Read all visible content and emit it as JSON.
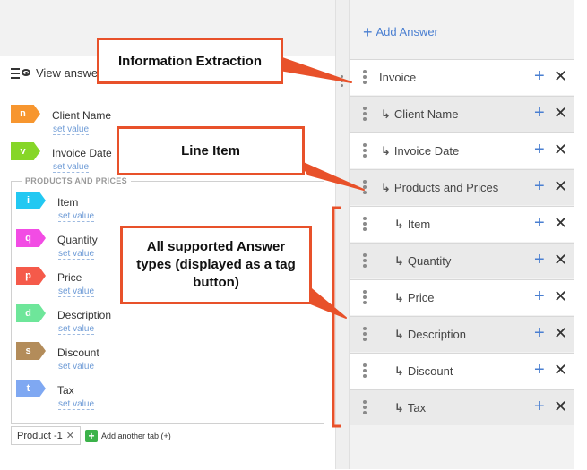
{
  "left": {
    "view_answers_label": "View answers",
    "fields": [
      {
        "tag": "n",
        "label": "Client Name",
        "set": "set value",
        "color": "#f7962f"
      },
      {
        "tag": "v",
        "label": "Invoice Date",
        "set": "set value",
        "color": "#86d628"
      }
    ],
    "group": {
      "title": "PRODUCTS AND PRICES",
      "items": [
        {
          "tag": "i",
          "label": "Item",
          "set": "set value",
          "color": "#22c8f2"
        },
        {
          "tag": "q",
          "label": "Quantity",
          "set": "set value",
          "color": "#f24ce4"
        },
        {
          "tag": "p",
          "label": "Price",
          "set": "set value",
          "color": "#f55a4a"
        },
        {
          "tag": "d",
          "label": "Description",
          "set": "set value",
          "color": "#6ee69a"
        },
        {
          "tag": "s",
          "label": "Discount",
          "set": "set value",
          "color": "#b38c5a"
        },
        {
          "tag": "t",
          "label": "Tax",
          "set": "set value",
          "color": "#7fa8f2"
        }
      ]
    },
    "tabs": {
      "product_tab": "Product -1",
      "close": "✕",
      "add_tab_label": "Add another tab (+)",
      "add_plus": "+"
    }
  },
  "right": {
    "add_answer_plus": "+",
    "add_answer_label": "Add Answer",
    "plus": "+",
    "close": "✕",
    "arrow": "↳",
    "rows": [
      {
        "label": "Invoice",
        "child": false
      },
      {
        "label": "Client Name",
        "child": true
      },
      {
        "label": "Invoice Date",
        "child": true
      },
      {
        "label": "Products and Prices",
        "child": true
      },
      {
        "label": "Item",
        "child": true
      },
      {
        "label": "Quantity",
        "child": true
      },
      {
        "label": "Price",
        "child": true
      },
      {
        "label": "Description",
        "child": true
      },
      {
        "label": "Discount",
        "child": true
      },
      {
        "label": "Tax",
        "child": true
      }
    ]
  },
  "callouts": {
    "info_extraction": "Information Extraction",
    "line_item": "Line Item",
    "answer_types": "All supported Answer types (displayed as a tag button)"
  },
  "colors": {
    "accent": "#4a7fd1",
    "callout_border": "#e8512a"
  }
}
